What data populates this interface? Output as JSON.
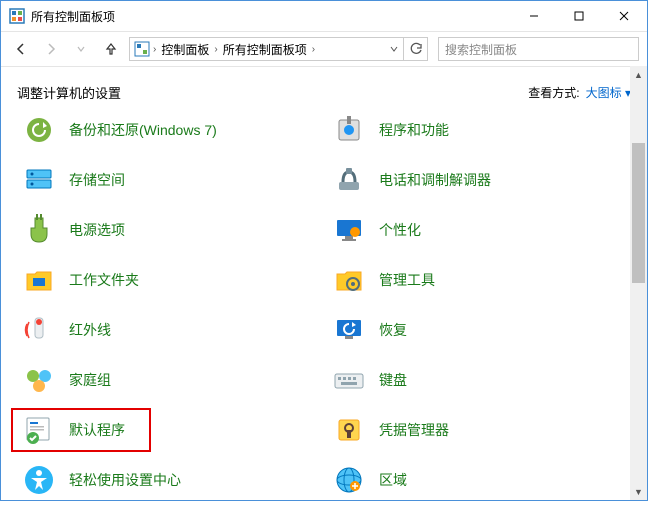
{
  "window": {
    "title": "所有控制面板项"
  },
  "breadcrumb": {
    "seg1": "控制面板",
    "seg2": "所有控制面板项"
  },
  "search": {
    "placeholder": "搜索控制面板"
  },
  "header": {
    "title": "调整计算机的设置",
    "view_label": "查看方式:",
    "view_value": "大图标"
  },
  "items": [
    {
      "label": "备份和还原(Windows 7)",
      "icon": "backup-restore-icon"
    },
    {
      "label": "程序和功能",
      "icon": "programs-features-icon"
    },
    {
      "label": "存储空间",
      "icon": "storage-spaces-icon"
    },
    {
      "label": "电话和调制解调器",
      "icon": "phone-modem-icon"
    },
    {
      "label": "电源选项",
      "icon": "power-options-icon"
    },
    {
      "label": "个性化",
      "icon": "personalization-icon"
    },
    {
      "label": "工作文件夹",
      "icon": "work-folders-icon"
    },
    {
      "label": "管理工具",
      "icon": "admin-tools-icon"
    },
    {
      "label": "红外线",
      "icon": "infrared-icon"
    },
    {
      "label": "恢复",
      "icon": "recovery-icon"
    },
    {
      "label": "家庭组",
      "icon": "homegroup-icon"
    },
    {
      "label": "键盘",
      "icon": "keyboard-icon"
    },
    {
      "label": "默认程序",
      "icon": "default-programs-icon"
    },
    {
      "label": "凭据管理器",
      "icon": "credential-manager-icon"
    },
    {
      "label": "轻松使用设置中心",
      "icon": "ease-of-access-icon"
    },
    {
      "label": "区域",
      "icon": "region-icon"
    }
  ],
  "highlighted_index": 12
}
